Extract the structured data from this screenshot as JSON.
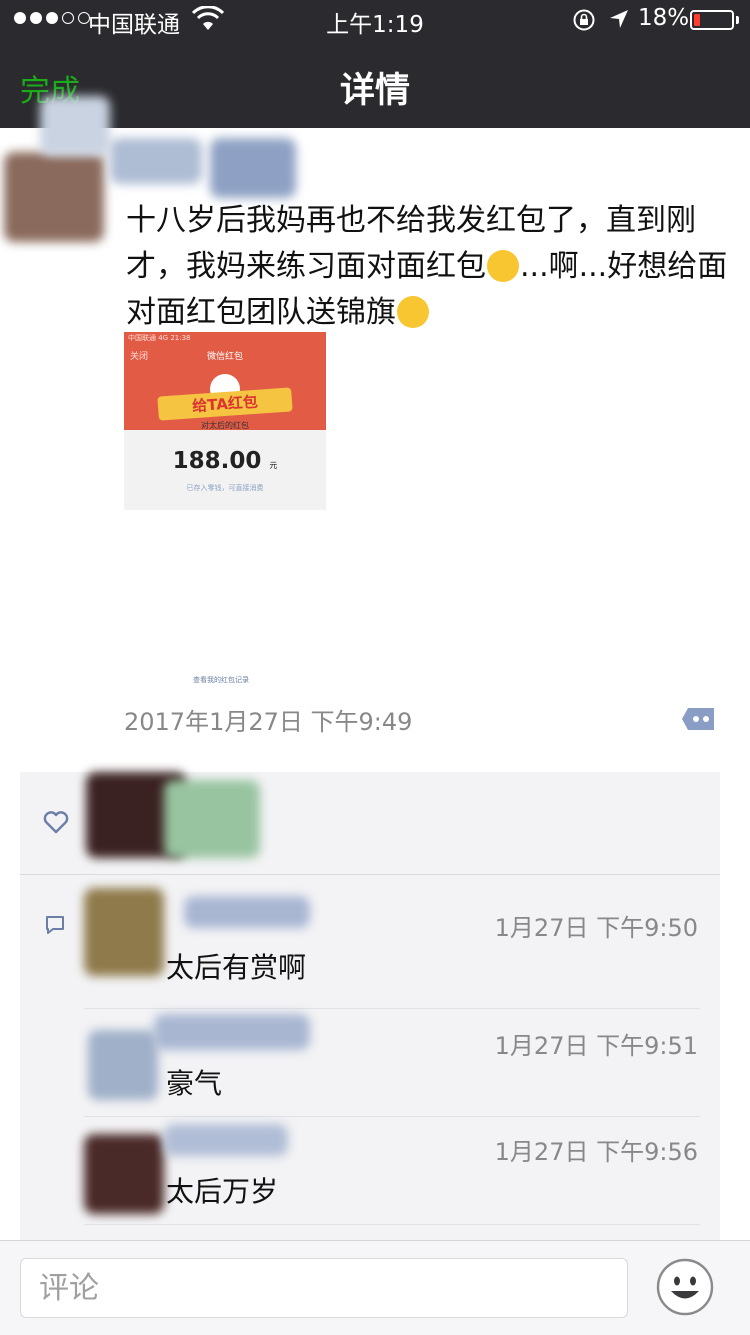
{
  "status_bar": {
    "carrier": "中国联通",
    "time": "上午1:19",
    "battery_percent": "18%",
    "battery_level": 0.18,
    "signal_bars": 3,
    "signal_total": 5,
    "icons": [
      "wifi-icon",
      "rotation-lock-icon",
      "location-arrow-icon",
      "battery-icon"
    ]
  },
  "nav": {
    "done_label": "完成",
    "title": "详情"
  },
  "post": {
    "text_part1": "十八岁后我妈再也不给我发红包了，直到刚才，我妈来练习面对面红包",
    "text_part2": "...啊...好想给面对面红包团队送锦旗",
    "emoji_1": "😳",
    "emoji_2": "😭",
    "screenshot": {
      "status": "中国联通 4G     21:38",
      "close": "关闭",
      "title": "微信红包",
      "banner": "给TA红包",
      "subtitle": "对太后的红包",
      "amount": "188.00",
      "unit": "元",
      "note": "已存入零钱，可直接消费",
      "link": "查看我的红包记录"
    },
    "time": "2017年1月27日 下午9:49"
  },
  "comments": [
    {
      "text": "太后有赏啊",
      "time": "1月27日 下午9:50"
    },
    {
      "text": "豪气",
      "time": "1月27日 下午9:51"
    },
    {
      "text": "太后万岁",
      "time": "1月27日 下午9:56"
    }
  ],
  "input": {
    "placeholder": "评论"
  },
  "colors": {
    "nav_bg": "#2b2b2f",
    "accent_green": "#1aad19",
    "link_blue": "#576b95",
    "battery_red": "#ff3b30",
    "redpacket_red": "#e25b45"
  }
}
